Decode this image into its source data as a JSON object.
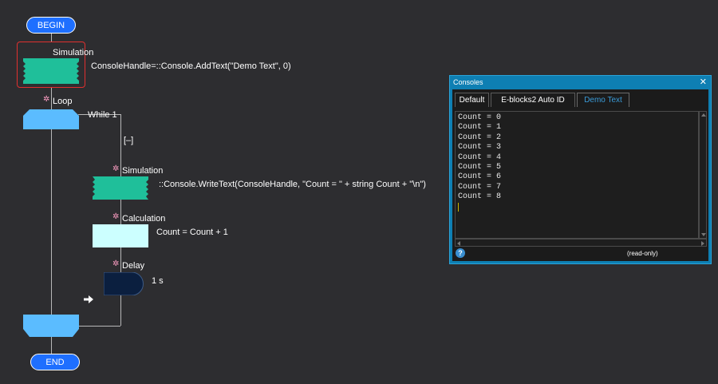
{
  "flowchart": {
    "begin_label": "BEGIN",
    "end_label": "END",
    "sim1": {
      "title": "Simulation",
      "text": "ConsoleHandle=::Console.AddText(\"Demo Text\", 0)"
    },
    "loop": {
      "title": "Loop",
      "condition": "While 1",
      "collapse": "[–]"
    },
    "sim2": {
      "title": "Simulation",
      "text": "::Console.WriteText(ConsoleHandle, \"Count = \" + string Count + \"\\n\")"
    },
    "calc": {
      "title": "Calculation",
      "text": "Count = Count + 1"
    },
    "delay": {
      "title": "Delay",
      "text": "1 s"
    },
    "colors": {
      "terminal": "#1e6fff",
      "simulation": "#1fbf9a",
      "loop": "#5bbcff",
      "calculation": "#ccffff",
      "delay": "#0b1f3f",
      "selection": "#e0302f"
    }
  },
  "console": {
    "title": "Consoles",
    "close_label": "✕",
    "tabs": [
      "Default",
      "E-blocks2 Auto ID",
      "Demo Text"
    ],
    "active_tab": "Demo Text",
    "lines": [
      "Count = 0",
      "Count = 1",
      "Count = 2",
      "Count = 3",
      "Count = 4",
      "Count = 5",
      "Count = 6",
      "Count = 7",
      "Count = 8"
    ],
    "status": "(read-only)",
    "help_icon": "help-icon"
  }
}
